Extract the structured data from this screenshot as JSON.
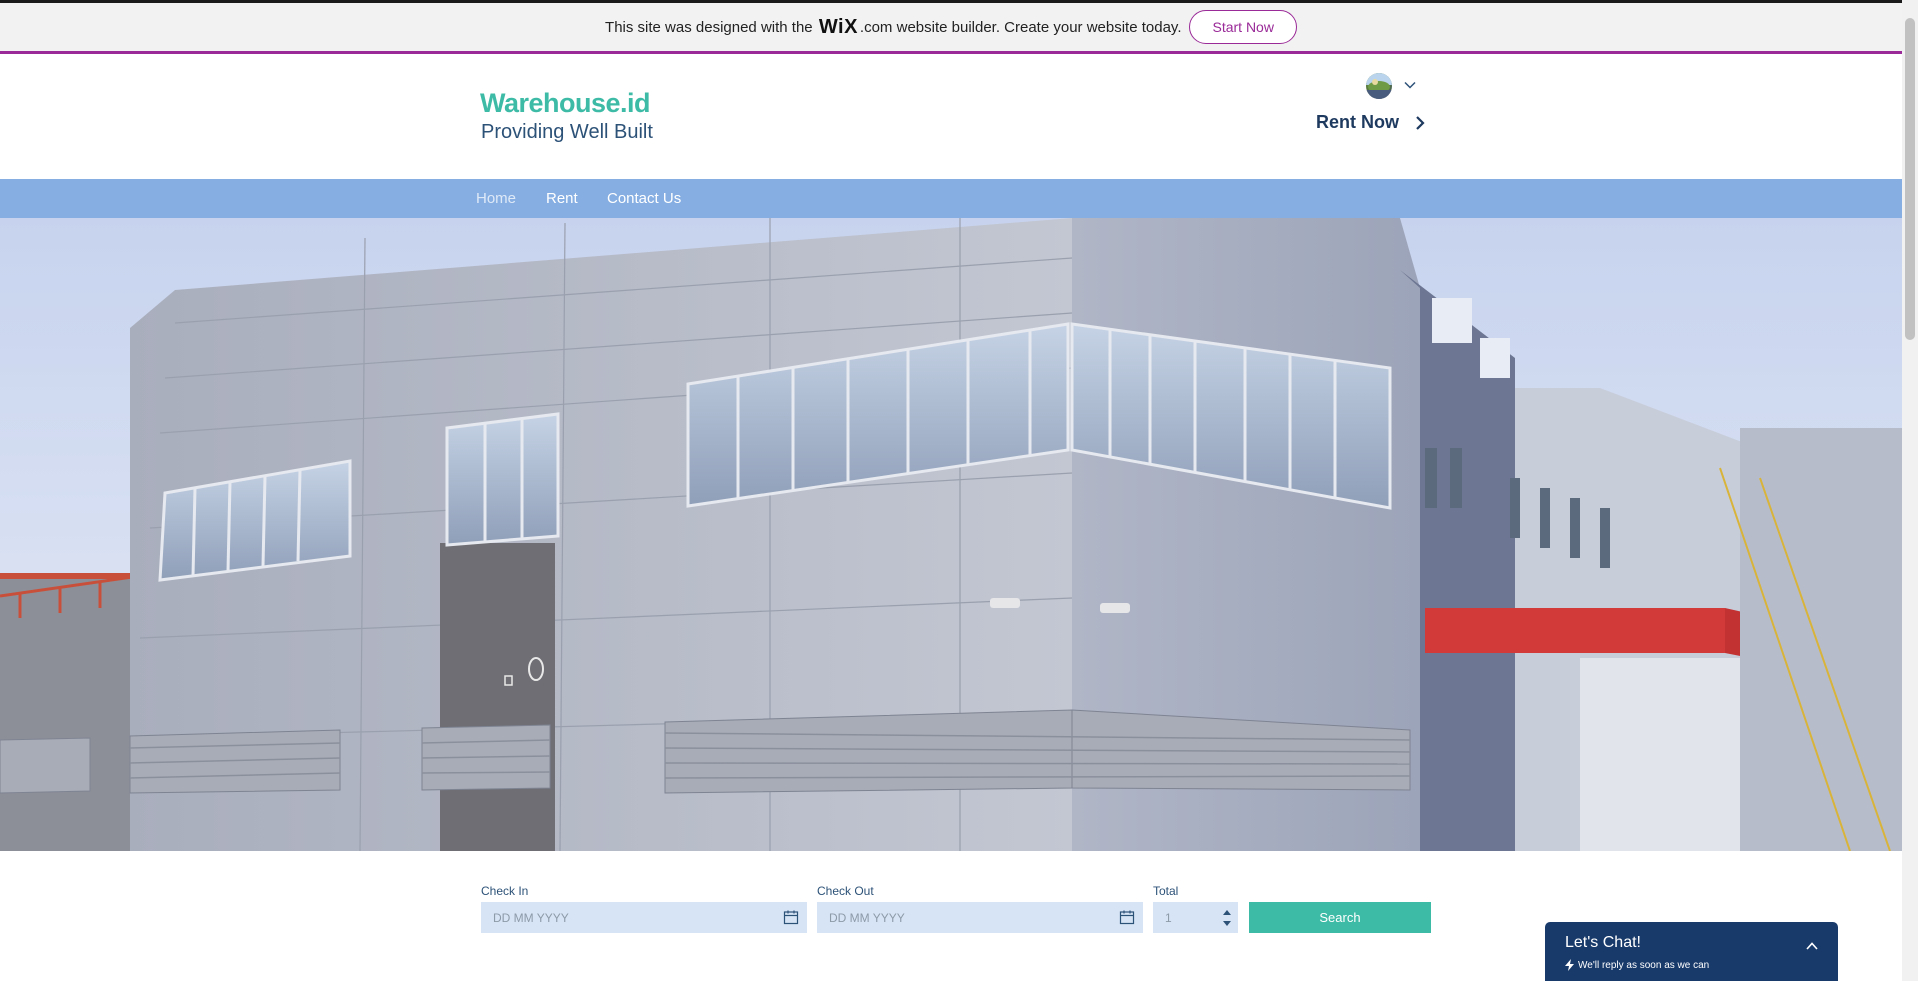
{
  "wix_banner": {
    "prefix": "This site was designed with the ",
    "brand": "WiX",
    "brand_suffix": ".com",
    "suffix": " website builder. Create your website today.",
    "cta": "Start Now"
  },
  "header": {
    "site_title": "Warehouse.id",
    "tagline": "Providing Well Built",
    "rent_now": "Rent Now"
  },
  "nav": {
    "items": [
      {
        "label": "Home",
        "active": true
      },
      {
        "label": "Rent"
      },
      {
        "label": "Contact Us"
      }
    ]
  },
  "booking": {
    "check_in_label": "Check In",
    "check_in_placeholder": "DD MM YYYY",
    "check_out_label": "Check Out",
    "check_out_placeholder": "DD MM YYYY",
    "total_label": "Total",
    "total_value": "1",
    "search_label": "Search"
  },
  "chat": {
    "title": "Let's Chat!",
    "subtitle": "We'll reply as soon as we can"
  },
  "colors": {
    "accent": "#3dbba6",
    "nav_bg": "#86aee2",
    "wix_purple": "#9a2a98",
    "chat_bg": "#183a6b"
  }
}
